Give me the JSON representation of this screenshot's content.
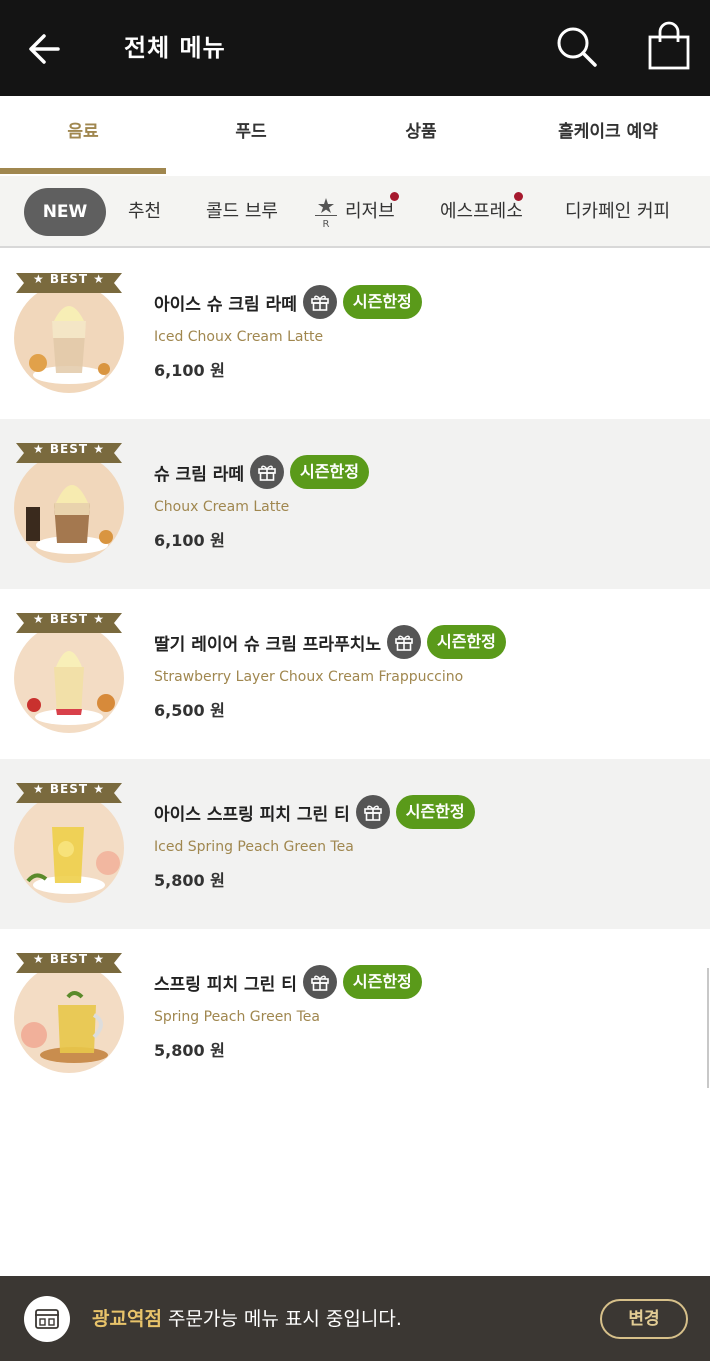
{
  "header": {
    "title": "전체 메뉴",
    "back_icon": "arrow-left-icon",
    "search_icon": "search-icon",
    "cart_icon": "shopping-bag-icon"
  },
  "tabs": [
    {
      "label": "음료",
      "active": true
    },
    {
      "label": "푸드",
      "active": false
    },
    {
      "label": "상품",
      "active": false
    },
    {
      "label": "홀케이크 예약",
      "active": false
    }
  ],
  "subtabs": [
    {
      "label": "NEW",
      "active": true
    },
    {
      "label": "추천"
    },
    {
      "label": "콜드 브루"
    },
    {
      "label": "리저브",
      "badge": true
    },
    {
      "label": "에스프레소",
      "badge": true
    },
    {
      "label": "디카페인 커피"
    }
  ],
  "reserve_mark": "R",
  "best_label": "★ BEST ★",
  "items": [
    {
      "name": "아이스 슈 크림 라떼",
      "en": "Iced Choux Cream Latte",
      "price": "6,100 원",
      "badge": "시즌한정"
    },
    {
      "name": "슈 크림 라떼",
      "en": "Choux Cream Latte",
      "price": "6,100 원",
      "badge": "시즌한정"
    },
    {
      "name": "딸기 레이어 슈 크림 프라푸치노",
      "en": "Strawberry Layer Choux Cream Frappuccino",
      "price": "6,500 원",
      "badge": "시즌한정"
    },
    {
      "name": "아이스 스프링 피치 그린 티",
      "en": "Iced Spring Peach Green Tea",
      "price": "5,800 원",
      "badge": "시즌한정"
    },
    {
      "name": "스프링 피치 그린 티",
      "en": "Spring Peach Green Tea",
      "price": "5,800 원",
      "badge": "시즌한정"
    }
  ],
  "footer": {
    "store": "광교역점",
    "message": " 주문가능 메뉴 표시 중입니다.",
    "change_label": "변경",
    "store_icon": "store-icon"
  },
  "colors": {
    "header_bg": "#141414",
    "accent_gold": "#a0874f",
    "season_green": "#5a9a1a",
    "footer_bg": "#3b3733",
    "badge_dot": "#a6192e"
  }
}
